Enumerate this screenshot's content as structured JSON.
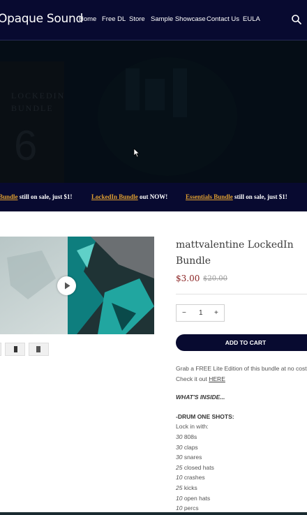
{
  "header": {
    "logo": "Opaque Sound",
    "nav": [
      "Home",
      "Free DL",
      "Store",
      "Sample Showcase",
      "Contact Us",
      "EULA"
    ]
  },
  "hero": {
    "cover_line1": "LOCKEDIN",
    "cover_line2": "BUNDLE",
    "cover_number": "6"
  },
  "ticker": [
    {
      "link": "Bundle",
      "text": " still on sale, just $1!"
    },
    {
      "link": "LockedIn Bundle",
      "text": " out NOW!"
    },
    {
      "link": "Essentials Bundle",
      "text": " still on sale, just $1!"
    }
  ],
  "product": {
    "title_line1": "mattvalentine LockedIn",
    "title_line2": "Bundle",
    "price": "$3.00",
    "compare_price": "$20.00",
    "qty_minus": "−",
    "qty_value": "1",
    "qty_plus": "+",
    "add_to_cart": "ADD TO CART"
  },
  "description": {
    "line1": "Grab a FREE Lite Edition of this bundle at no cost!",
    "line2_prefix": "Check it out ",
    "line2_link": "HERE",
    "whats_inside": "WHAT'S INSIDE...",
    "section": "-DRUM ONE SHOTS:",
    "lock_in": "Lock in with:",
    "items": [
      {
        "count": "30",
        "label": " 808s"
      },
      {
        "count": "30",
        "label": " claps"
      },
      {
        "count": "30",
        "label": " snares"
      },
      {
        "count": "25",
        "label": " closed hats"
      },
      {
        "count": "10",
        "label": " crashes"
      },
      {
        "count": "25",
        "label": " kicks"
      },
      {
        "count": "10",
        "label": " open hats"
      },
      {
        "count": "10",
        "label": " percs"
      }
    ]
  }
}
